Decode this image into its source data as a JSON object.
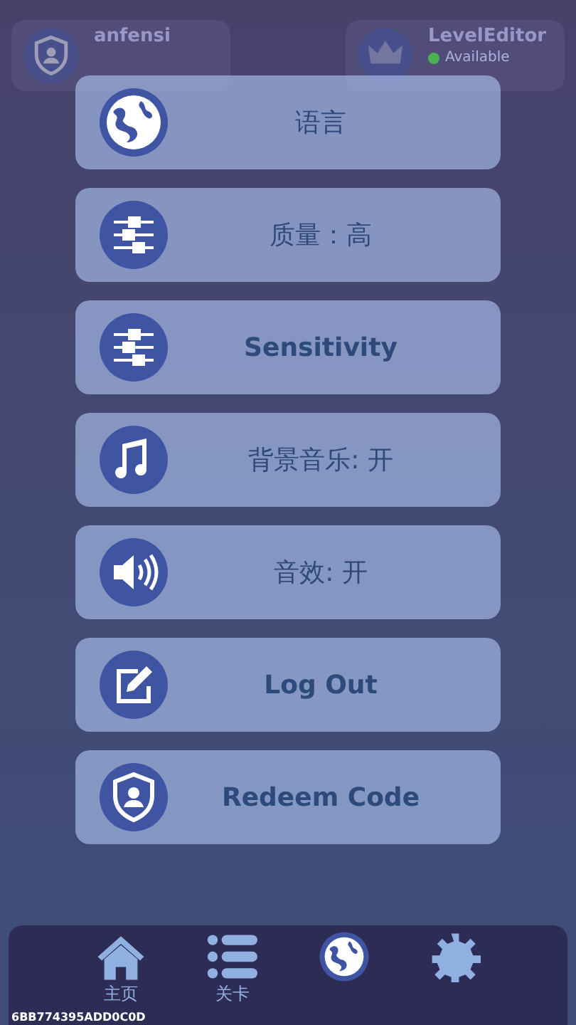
{
  "background_cards": [
    {
      "kind": "shield",
      "title": "anfensi"
    },
    {
      "kind": "crown",
      "title": "LevelEditor",
      "status": "Available",
      "color": "#4caf50"
    }
  ],
  "menu": [
    {
      "kind": "globe",
      "label": "语言",
      "bold": false
    },
    {
      "kind": "sliders",
      "label": "质量：高",
      "bold": false
    },
    {
      "kind": "sliders",
      "label": "Sensitivity",
      "bold": true
    },
    {
      "kind": "music",
      "label": "背景音乐: 开",
      "bold": false
    },
    {
      "kind": "speaker",
      "label": "音效: 开",
      "bold": false
    },
    {
      "kind": "edit",
      "label": "Log Out",
      "bold": true
    },
    {
      "kind": "shield",
      "label": "Redeem Code",
      "bold": true
    }
  ],
  "device_id": "6BB774395ADD0C0D",
  "nav": [
    {
      "kind": "home",
      "label": "主页"
    },
    {
      "kind": "list",
      "label": "关卡"
    },
    {
      "kind": "globe"
    },
    {
      "kind": "gear"
    }
  ]
}
